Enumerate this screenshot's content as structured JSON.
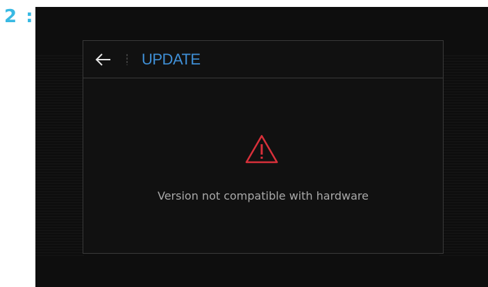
{
  "step_label": "2 :",
  "header": {
    "back_icon": "arrow-left-icon",
    "title": "UPDATE"
  },
  "body": {
    "warning_icon": "warning-triangle-icon",
    "message": "Version not compatible with hardware"
  },
  "colors": {
    "step_label": "#38b9e3",
    "title": "#3f8fd6",
    "warning": "#d8303a",
    "message": "#a9a9a9",
    "background": "#0e0e0e"
  }
}
